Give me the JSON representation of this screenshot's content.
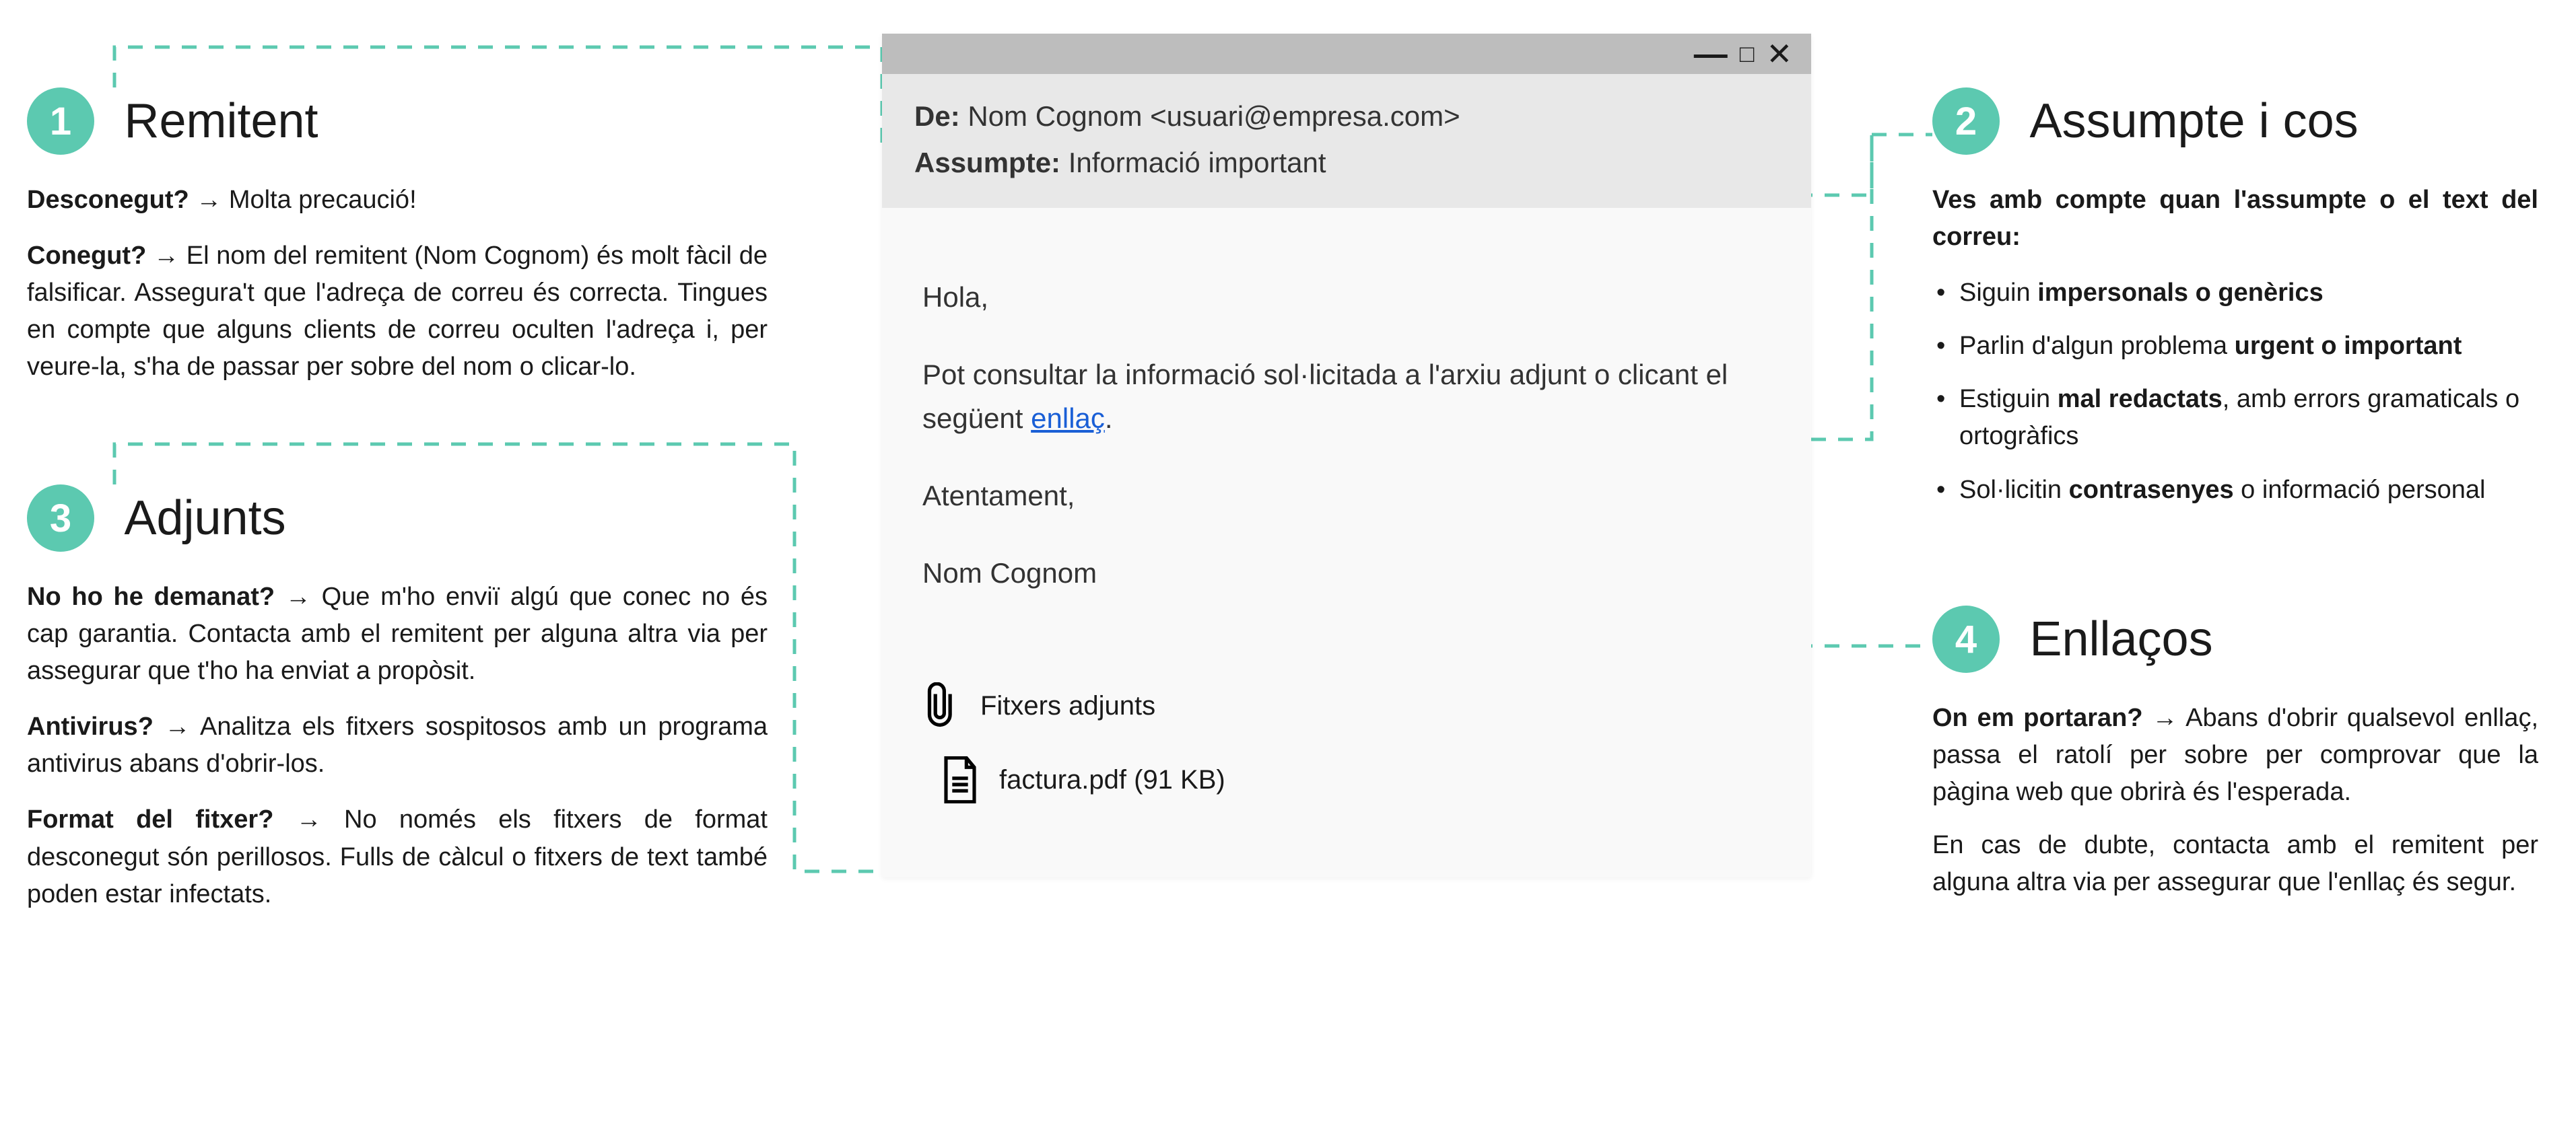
{
  "accent": "#5cc9b0",
  "sections": {
    "s1": {
      "num": "1",
      "title": "Remitent",
      "p1a": "Desconegut?",
      "p1b": " Molta precaució!",
      "p2a": "Conegut?",
      "p2b": " El nom del remitent (Nom Cognom) és molt fàcil de falsificar. Assegura't que l'adreça de correu és correcta. Tingues en compte que alguns clients de correu oculten l'adreça i, per veure-la, s'ha de passar per sobre del nom o clicar-lo."
    },
    "s2": {
      "num": "2",
      "title": "Assumpte i cos",
      "intro": "Ves amb compte quan l'assumpte o el text del correu:",
      "li1a": "Siguin ",
      "li1b": "impersonals o genèrics",
      "li2a": "Parlin d'algun problema ",
      "li2b": "urgent o important",
      "li3a": "Estiguin ",
      "li3b": "mal redactats",
      "li3c": ", amb errors gramaticals o ortogràfics",
      "li4a": "Sol·licitin ",
      "li4b": "contrasenyes",
      "li4c": " o informació personal"
    },
    "s3": {
      "num": "3",
      "title": "Adjunts",
      "p1a": "No ho he demanat?",
      "p1b": " Que m'ho enviï algú que conec no és cap garantia. Contacta amb el remitent per alguna altra via per assegurar que t'ho ha enviat a propòsit.",
      "p2a": "Antivirus?",
      "p2b": " Analitza els fitxers sospitosos amb un programa antivirus abans d'obrir-los.",
      "p3a": "Format del fitxer?",
      "p3b": " No només els fitxers de format desconegut són perillosos. Fulls de càlcul o fitxers de text també poden estar infectats."
    },
    "s4": {
      "num": "4",
      "title": "Enllaços",
      "p1a": "On em portaran?",
      "p1b": " Abans d'obrir qualsevol enllaç, passa el ratolí per sobre per comprovar que la pàgina web que obrirà és l'esperada.",
      "p2": "En cas de dubte, contacta amb el remitent per alguna altra via per assegurar que l'enllaç és segur."
    }
  },
  "email": {
    "from_label": "De:",
    "from_value": " Nom Cognom <usuari@empresa.com>",
    "subj_label": "Assumpte:",
    "subj_value": " Informació important",
    "greeting": "Hola,",
    "body_pre": "Pot consultar la informació sol·licitada a l'arxiu adjunt o clicant el següent ",
    "body_link": "enllaç",
    "body_post": ".",
    "closing": "Atentament,",
    "sign": "Nom Cognom",
    "attach_label": "Fitxers adjunts",
    "attach_file": "factura.pdf (91 KB)"
  },
  "arrow": "→"
}
